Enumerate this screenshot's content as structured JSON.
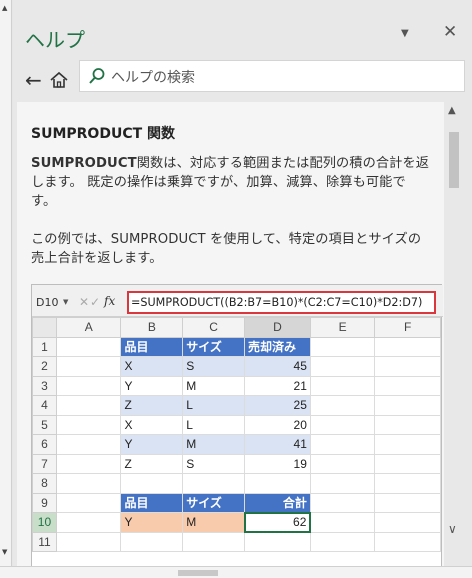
{
  "pane": {
    "title": "ヘルプ",
    "menu_glyph": "▼",
    "close_glyph": "✕"
  },
  "nav": {
    "back_glyph": "←"
  },
  "search": {
    "placeholder": "ヘルプの検索"
  },
  "article": {
    "heading": "SUMPRODUCT 関数",
    "para1_bold": "SUMPRODUCT",
    "para1_line1_rest": "関数は、対応する範囲または配列の積の合計を返",
    "para1_line2": "します。 既定の操作は乗算ですが、加算、減算、除算も可能で",
    "para1_line3": "す。",
    "para2_line1": "この例では、SUMPRODUCT を使用して、特定の項目とサイズの",
    "para2_line2": "売上合計を返します。"
  },
  "excel": {
    "name_box": "D10",
    "formula": "=SUMPRODUCT((B2:B7=B10)*(C2:C7=C10)*D2:D7)",
    "columns": [
      "A",
      "B",
      "C",
      "D",
      "E",
      "F"
    ],
    "rows": [
      {
        "n": "1",
        "b": "品目",
        "c": "サイズ",
        "d": "売却済み"
      },
      {
        "n": "2",
        "b": "X",
        "c": "S",
        "d": "45"
      },
      {
        "n": "3",
        "b": "Y",
        "c": "M",
        "d": "21"
      },
      {
        "n": "4",
        "b": "Z",
        "c": "L",
        "d": "25"
      },
      {
        "n": "5",
        "b": "X",
        "c": "L",
        "d": "20"
      },
      {
        "n": "6",
        "b": "Y",
        "c": "M",
        "d": "41"
      },
      {
        "n": "7",
        "b": "Z",
        "c": "S",
        "d": "19"
      },
      {
        "n": "8",
        "b": "",
        "c": "",
        "d": ""
      },
      {
        "n": "9",
        "b": "品目",
        "c": "サイズ",
        "d": "合計"
      },
      {
        "n": "10",
        "b": "Y",
        "c": "M",
        "d": "62"
      },
      {
        "n": "11",
        "b": "",
        "c": "",
        "d": ""
      }
    ]
  },
  "colors": {
    "accent": "#217346",
    "table_header": "#4472c4",
    "band": "#dae3f3",
    "input_highlight": "#f8cbad",
    "formula_border": "#d9363e"
  }
}
